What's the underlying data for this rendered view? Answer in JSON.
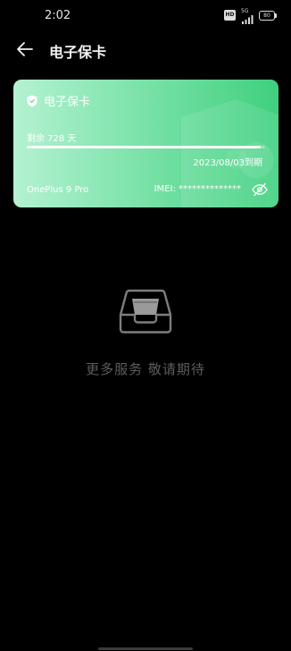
{
  "status_bar": {
    "time": "2:02",
    "hd_label": "HD",
    "signal_label": "5G",
    "battery_level": "80"
  },
  "header": {
    "title": "电子保卡"
  },
  "card": {
    "title": "电子保卡",
    "days_remaining": "剩余 728 天",
    "remaining_fraction": 0.98,
    "expiry": "2023/08/03到期",
    "device_name": "OnePlus 9 Pro",
    "imei": "IMEI: **************"
  },
  "empty_state": {
    "message": "更多服务 敬请期待"
  },
  "colors": {
    "card_gradient_start": "#b4f2d2",
    "card_gradient_end": "#3fd07f",
    "background": "#000000",
    "empty_text": "#5d5d5d"
  }
}
